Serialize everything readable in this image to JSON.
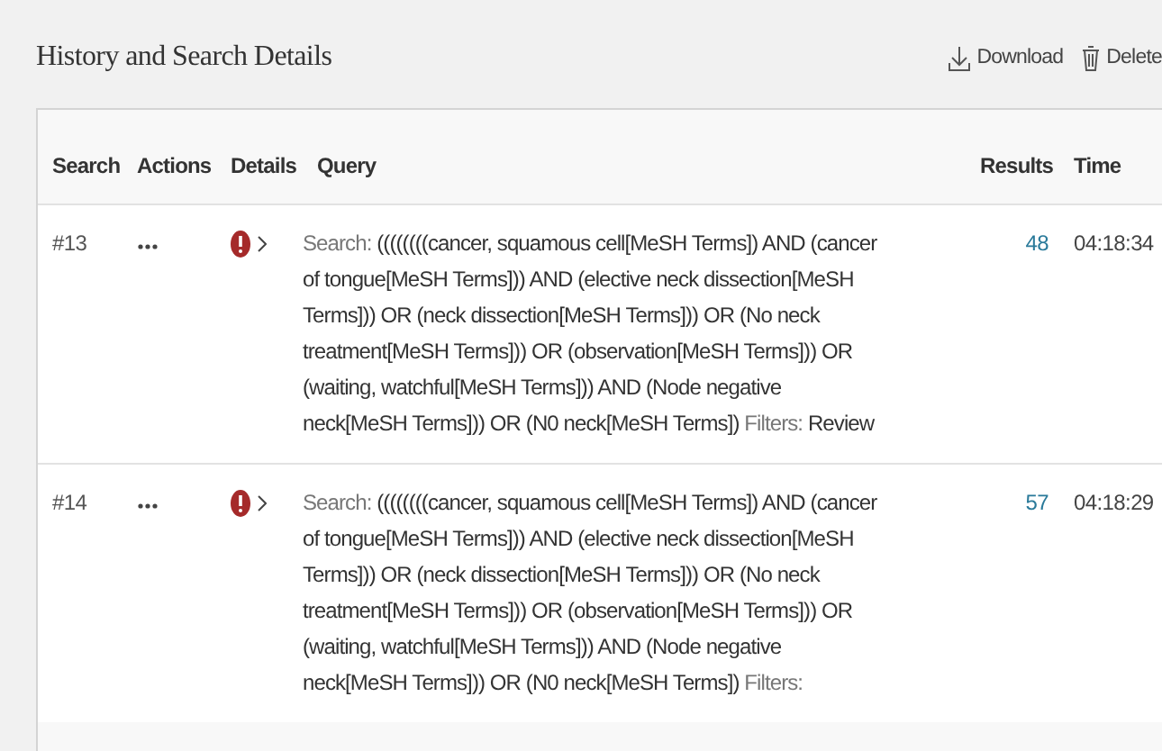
{
  "header": {
    "title": "History and Search Details",
    "actions": [
      {
        "kind": "download",
        "label": "Download"
      },
      {
        "kind": "delete",
        "label": "Delete"
      }
    ]
  },
  "table": {
    "columns": [
      "Search",
      "Actions",
      "Details",
      "Query",
      "Results",
      "Time"
    ],
    "rows": [
      {
        "search": "#13",
        "query_prefix": "Search:",
        "query_lines": [
          "((((((((cancer, squamous cell[MeSH Terms]) AND (cancer",
          "of tongue[MeSH Terms])) AND (elective neck dissection[MeSH",
          "Terms])) OR (neck dissection[MeSH Terms])) OR (No neck",
          "treatment[MeSH Terms])) OR (observation[MeSH Terms])) OR",
          "(waiting, watchful[MeSH Terms])) AND (Node negative",
          "neck[MeSH Terms])) OR (N0 neck[MeSH Terms])"
        ],
        "filters_label": "Filters:",
        "filters": "Review",
        "results": "48",
        "time": "04:18:34"
      },
      {
        "search": "#14",
        "query_prefix": "Search:",
        "query_lines": [
          "((((((((cancer, squamous cell[MeSH Terms]) AND (cancer",
          "of tongue[MeSH Terms])) AND (elective neck dissection[MeSH",
          "Terms])) OR (neck dissection[MeSH Terms])) OR (No neck",
          "treatment[MeSH Terms])) OR (observation[MeSH Terms])) OR",
          "(waiting, watchful[MeSH Terms])) AND (Node negative",
          "neck[MeSH Terms])) OR (N0 neck[MeSH Terms])"
        ],
        "filters_label": "Filters:",
        "results": "57",
        "time": "04:18:29"
      }
    ]
  }
}
